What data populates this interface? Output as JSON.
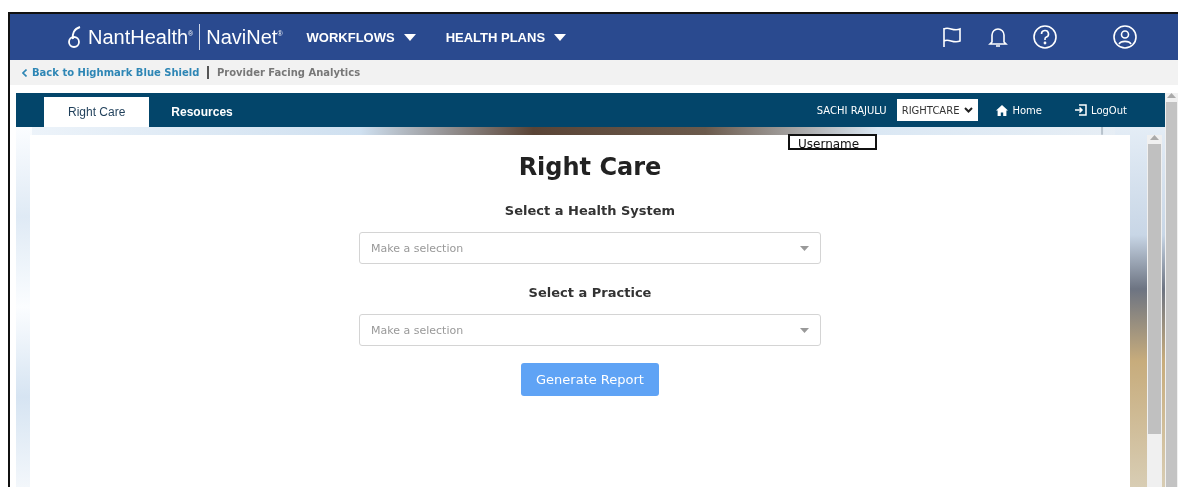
{
  "header": {
    "logo_brand": "NantHealth$^{®}$",
    "logo_product": "NaviNet$^{®}$",
    "menus": [
      {
        "label": "WORKFLOWS"
      },
      {
        "label": "HEALTH PLANS"
      }
    ]
  },
  "breadcrumb": {
    "back_link": "Back to Highmark Blue Shield",
    "current": "Provider Facing Analytics"
  },
  "app_tabs": [
    {
      "label": "Right Care",
      "selected": true
    },
    {
      "label": "Resources",
      "selected": false
    }
  ],
  "user_bar": {
    "user_name": "SACHI RAJULU",
    "role_select": "RIGHTCARE",
    "links": [
      {
        "kind": "home",
        "label": "Home"
      },
      {
        "kind": "logout",
        "label": "LogOut"
      }
    ]
  },
  "annotation": {
    "label": "Username"
  },
  "form": {
    "title": "Right Care",
    "fields": [
      {
        "label": "Select a Health System",
        "placeholder": "Make a selection"
      },
      {
        "label": "Select a Practice",
        "placeholder": "Make a selection"
      }
    ],
    "button": "Generate Report"
  }
}
